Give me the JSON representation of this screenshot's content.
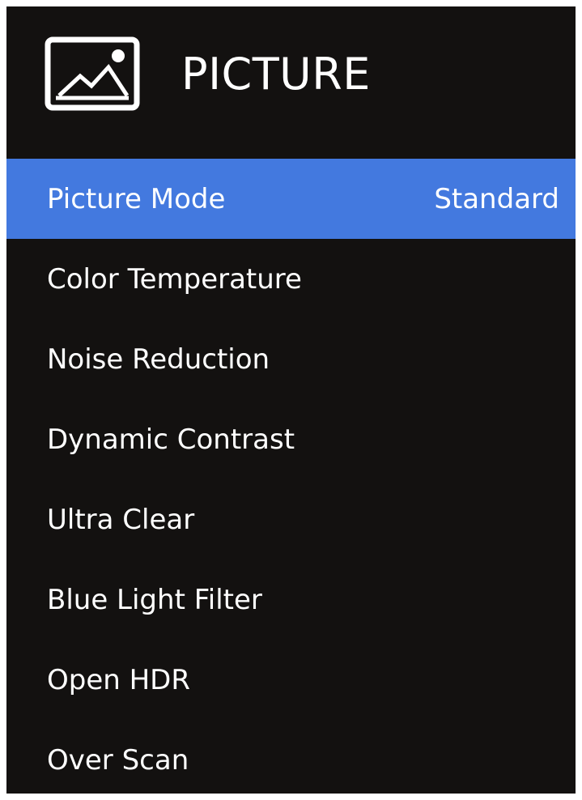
{
  "header": {
    "title": "PICTURE",
    "icon": "picture-icon"
  },
  "menu": {
    "items": [
      {
        "label": "Picture Mode",
        "value": "Standard",
        "selected": true
      },
      {
        "label": "Color Temperature"
      },
      {
        "label": "Noise Reduction"
      },
      {
        "label": "Dynamic Contrast"
      },
      {
        "label": "Ultra Clear"
      },
      {
        "label": "Blue Light Filter"
      },
      {
        "label": "Open HDR"
      },
      {
        "label": "Over Scan"
      }
    ]
  },
  "colors": {
    "background": "#131110",
    "highlight": "#4379df",
    "text": "#ffffff",
    "page": "#ffffff"
  }
}
